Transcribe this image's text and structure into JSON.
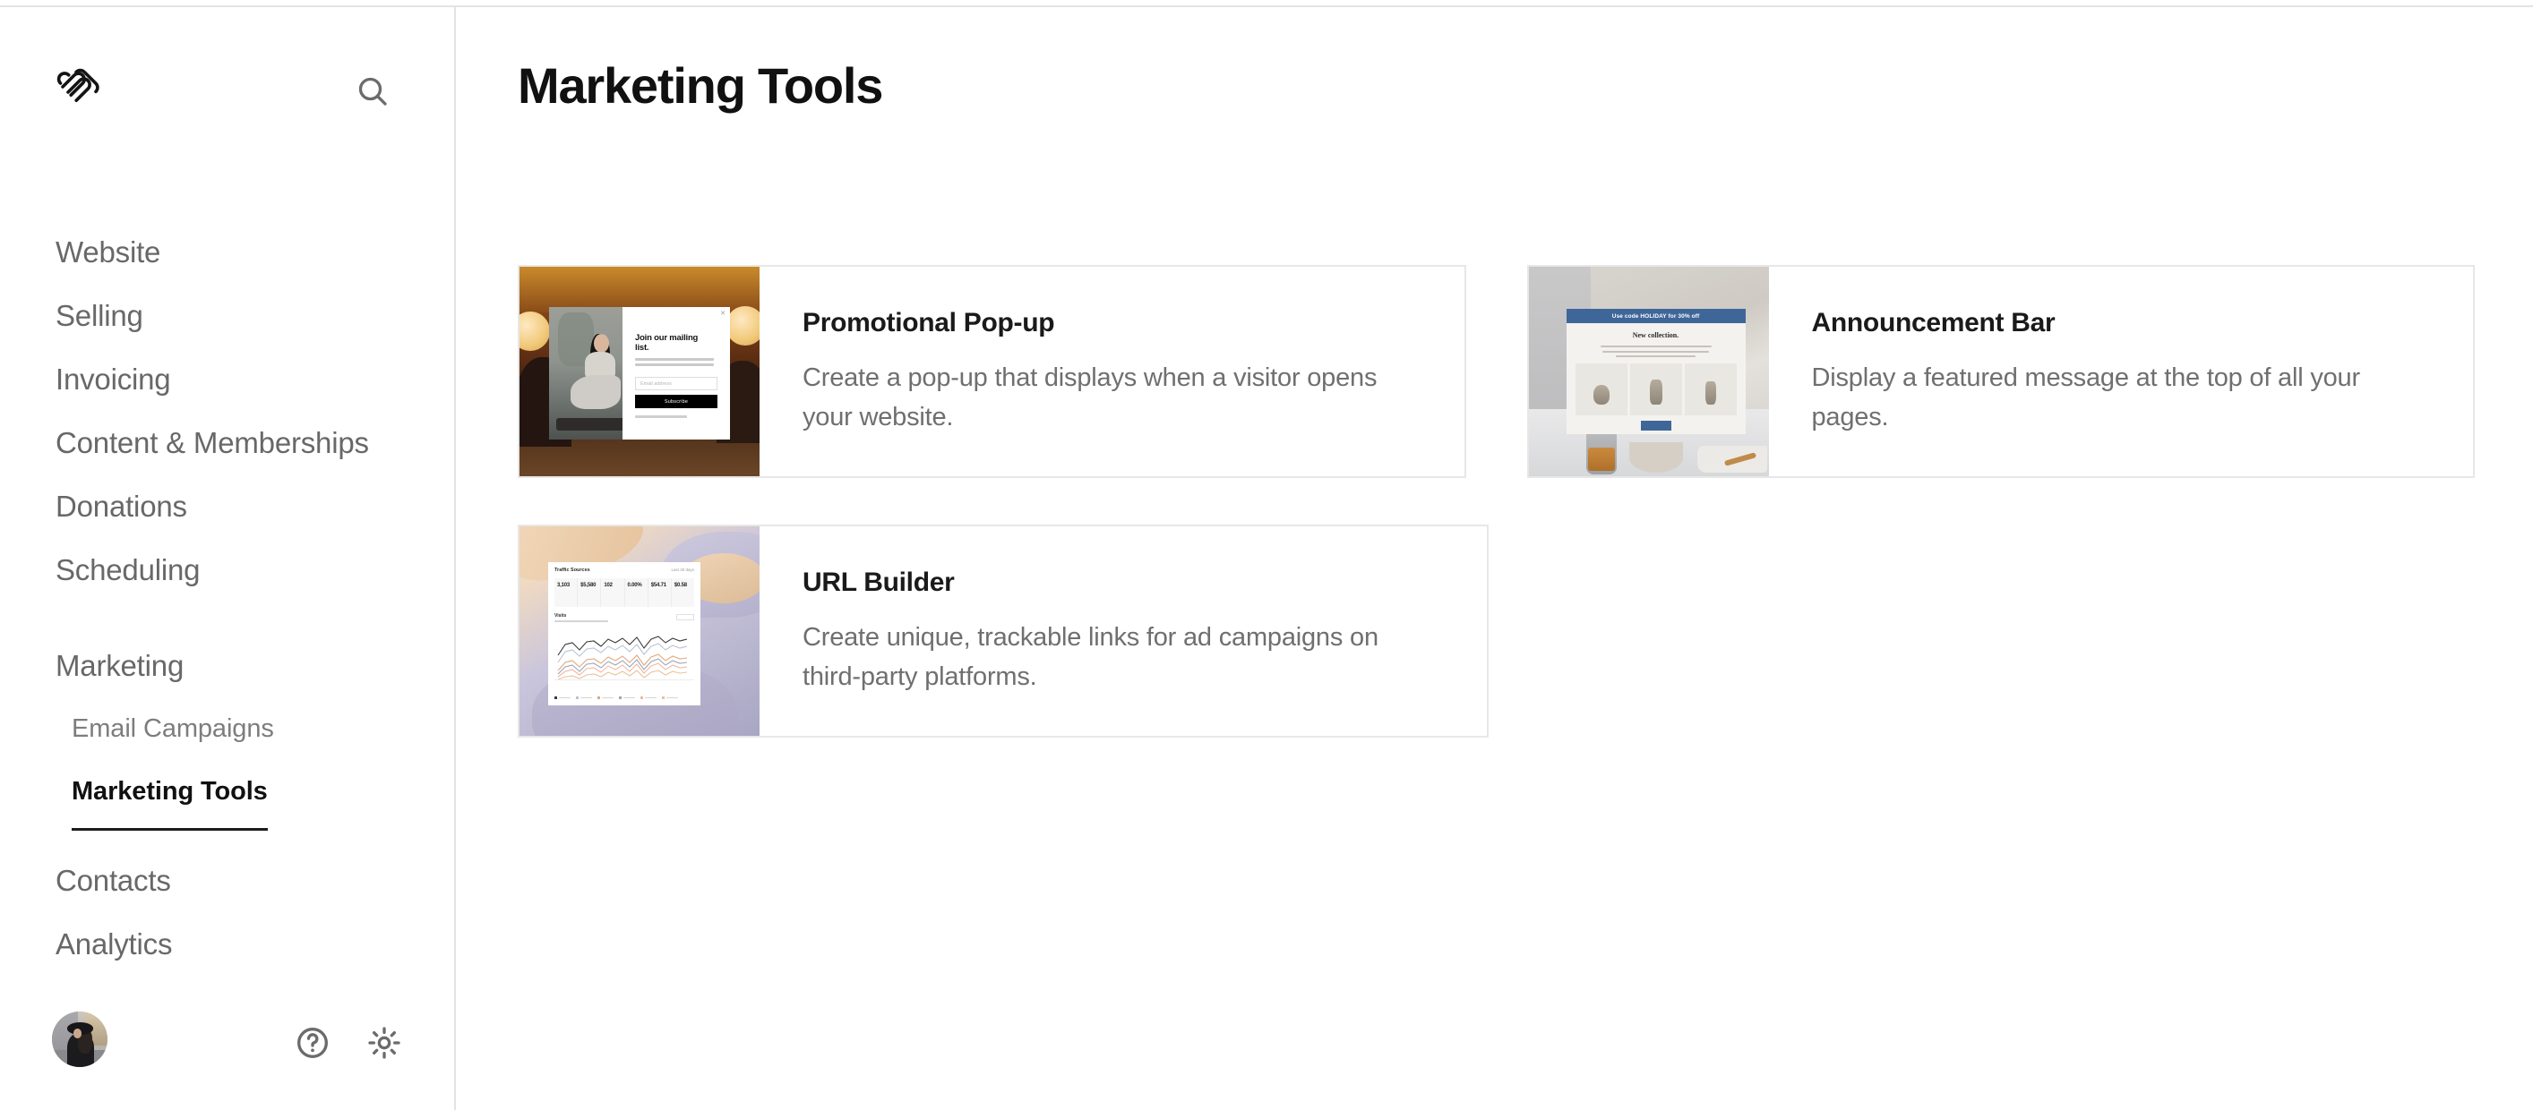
{
  "app": {
    "brand_logo": "squarespace-logo",
    "accent_blue": "#3f6699",
    "text_dark": "#111111",
    "text_muted": "#6f6f6f",
    "border": "#e7e7e7"
  },
  "sidebar": {
    "search_label": "Search",
    "primary_items": [
      {
        "label": "Website"
      },
      {
        "label": "Selling"
      },
      {
        "label": "Invoicing"
      },
      {
        "label": "Content & Memberships"
      },
      {
        "label": "Donations"
      },
      {
        "label": "Scheduling"
      }
    ],
    "marketing_group": {
      "label": "Marketing",
      "children": [
        {
          "label": "Email Campaigns",
          "active": false
        },
        {
          "label": "Marketing Tools",
          "active": true
        }
      ]
    },
    "lower_items": [
      {
        "label": "Contacts"
      },
      {
        "label": "Analytics"
      }
    ],
    "footer": {
      "avatar_label": "User avatar",
      "help_label": "Help",
      "settings_label": "Settings"
    }
  },
  "main": {
    "title": "Marketing Tools",
    "cards": [
      {
        "title": "Promotional Pop-up",
        "description": "Create a pop-up that displays when a visitor opens your website.",
        "thumbnail": {
          "kind": "promotional-popup-preview",
          "heading": "Join our mailing list.",
          "input_placeholder": "Email address",
          "button_label": "Subscribe"
        }
      },
      {
        "title": "Announcement Bar",
        "description": "Display a featured message at the top of all your pages.",
        "thumbnail": {
          "kind": "announcement-bar-preview",
          "bar_text": "Use code HOLIDAY for 30% off",
          "page_heading": "New collection.",
          "bar_color": "#3f6699"
        }
      },
      {
        "title": "URL Builder",
        "description": "Create unique, trackable links for ad campaigns on third-party platforms.",
        "thumbnail": {
          "kind": "url-builder-preview",
          "panel_title": "Traffic Sources",
          "panel_range": "Last 30 days",
          "section_title": "Visits",
          "stats": [
            "3,103",
            "$5,580",
            "102",
            "0.00%",
            "$54.71",
            "$0.58"
          ],
          "series_colors": [
            "#3a3a3a",
            "#b9c2d6",
            "#e0a87a",
            "#9aa6b8",
            "#f0b7a0",
            "#e8c39a"
          ]
        }
      }
    ]
  }
}
